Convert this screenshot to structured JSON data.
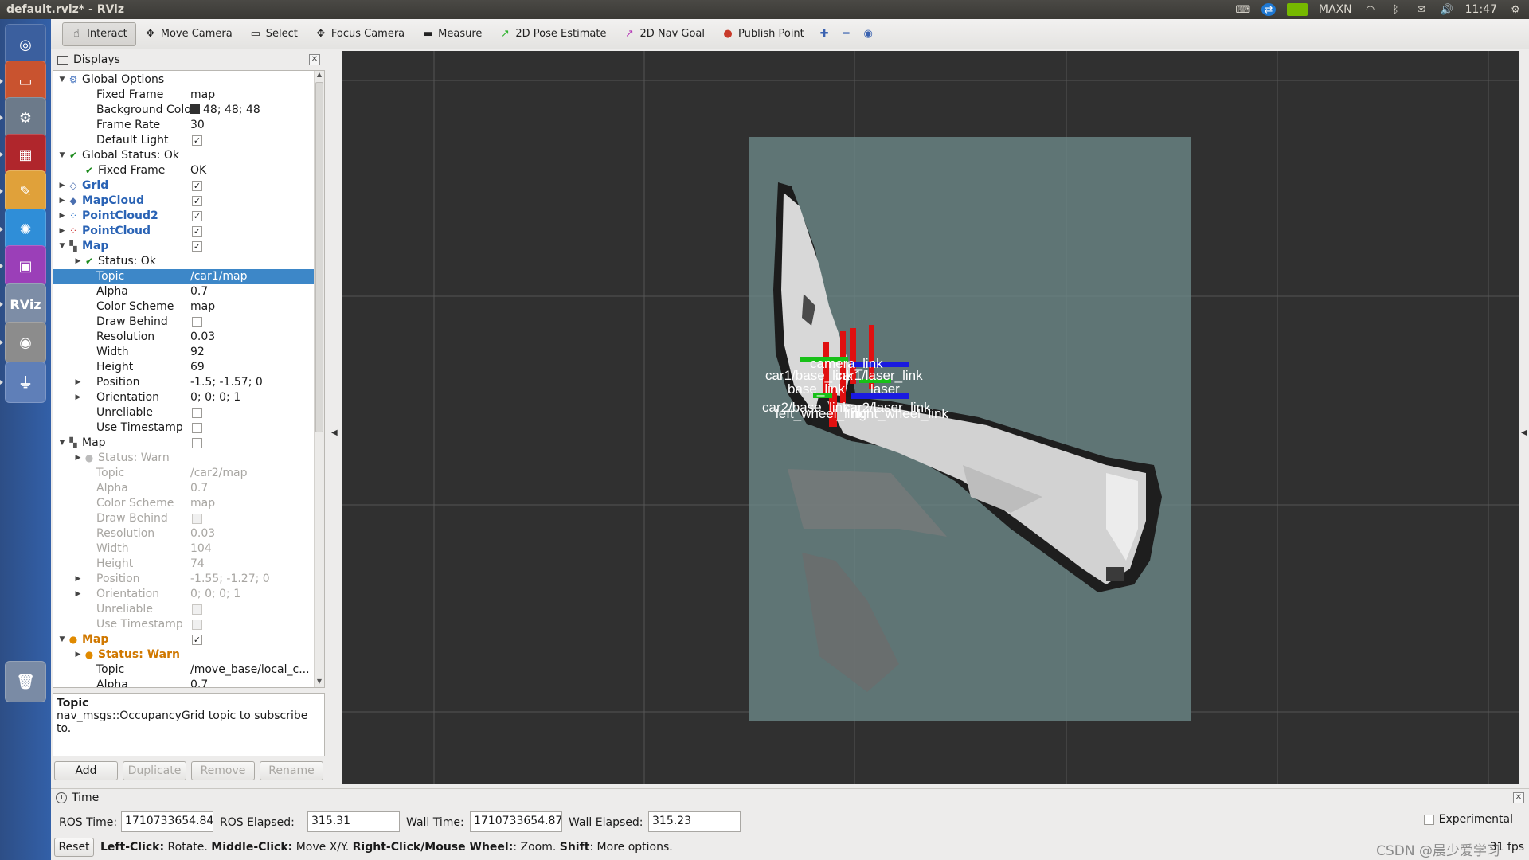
{
  "window": {
    "title": "default.rviz* - RViz"
  },
  "tray": {
    "network_label": "MAXN",
    "clock": "11:47"
  },
  "launcher": [
    {
      "name": "ubuntu-dash",
      "glyph": "◎",
      "color": "#3b5f9e"
    },
    {
      "name": "files",
      "glyph": "▭",
      "color": "#c9532f"
    },
    {
      "name": "system-settings",
      "glyph": "⚙",
      "color": "#6c7a8a"
    },
    {
      "name": "terminal-app",
      "glyph": "▦",
      "color": "#b0262c"
    },
    {
      "name": "text-editor",
      "glyph": "✎",
      "color": "#e0a13a"
    },
    {
      "name": "weather-app",
      "glyph": "✺",
      "color": "#2f8ed8"
    },
    {
      "name": "remote-desktop",
      "glyph": "▣",
      "color": "#9b3fb8"
    },
    {
      "name": "rviz-app",
      "glyph": "RViz",
      "color": "#7d8da6"
    },
    {
      "name": "screenshot-app",
      "glyph": "◉",
      "color": "#8c8c8c"
    },
    {
      "name": "usb-drive",
      "glyph": "⏚",
      "color": "#5f7fb8"
    },
    {
      "name": "trash",
      "glyph": "🗑",
      "color": "#7a8ba5"
    }
  ],
  "toolbar": {
    "tools": [
      {
        "label": "Interact",
        "icon": "hand-icon",
        "glyph": "☝",
        "active": true
      },
      {
        "label": "Move Camera",
        "icon": "move-camera-icon",
        "glyph": "✥"
      },
      {
        "label": "Select",
        "icon": "select-icon",
        "glyph": "▭"
      },
      {
        "label": "Focus Camera",
        "icon": "focus-camera-icon",
        "glyph": "✥"
      },
      {
        "label": "Measure",
        "icon": "ruler-icon",
        "glyph": "▬"
      },
      {
        "label": "2D Pose Estimate",
        "icon": "pose-arrow-icon",
        "glyph": "↗",
        "color": "#2db32d"
      },
      {
        "label": "2D Nav Goal",
        "icon": "nav-goal-arrow-icon",
        "glyph": "↗",
        "color": "#b12db3"
      },
      {
        "label": "Publish Point",
        "icon": "map-pin-icon",
        "glyph": "●",
        "color": "#c83a2a"
      }
    ],
    "extras": [
      "plus-icon",
      "minus-icon",
      "eye-icon"
    ]
  },
  "displays": {
    "title": "Displays",
    "rows": [
      {
        "indent": 0,
        "arrow": "down",
        "icon": "globe-icon",
        "label": "Global Options",
        "value": ""
      },
      {
        "indent": 1,
        "label": "Fixed Frame",
        "value": "map"
      },
      {
        "indent": 1,
        "label": "Background Color",
        "value": "48; 48; 48",
        "swatch": "#303030"
      },
      {
        "indent": 1,
        "label": "Frame Rate",
        "value": "30"
      },
      {
        "indent": 1,
        "label": "Default Light",
        "check": true
      },
      {
        "indent": 0,
        "arrow": "down",
        "icon": "check-icon",
        "label": "Global Status: Ok",
        "value": ""
      },
      {
        "indent": 1,
        "icon": "check-icon",
        "label": "Fixed Frame",
        "value": "OK"
      },
      {
        "indent": 0,
        "arrow": "right",
        "icon": "grid-icon",
        "label": "Grid",
        "check": true,
        "style": "blue"
      },
      {
        "indent": 0,
        "arrow": "right",
        "icon": "mapcloud-icon",
        "label": "MapCloud",
        "check": true,
        "style": "blue"
      },
      {
        "indent": 0,
        "arrow": "right",
        "icon": "pointcloud2-icon",
        "label": "PointCloud2",
        "check": true,
        "style": "blue"
      },
      {
        "indent": 0,
        "arrow": "right",
        "icon": "pointcloud-icon",
        "label": "PointCloud",
        "check": true,
        "style": "blue"
      },
      {
        "indent": 0,
        "arrow": "down",
        "icon": "map-icon",
        "label": "Map",
        "check": true,
        "style": "blue"
      },
      {
        "indent": 1,
        "arrow": "right",
        "icon": "check-icon",
        "label": "Status: Ok",
        "value": ""
      },
      {
        "indent": 1,
        "label": "Topic",
        "value": "/car1/map",
        "selected": true
      },
      {
        "indent": 1,
        "label": "Alpha",
        "value": "0.7"
      },
      {
        "indent": 1,
        "label": "Color Scheme",
        "value": "map"
      },
      {
        "indent": 1,
        "label": "Draw Behind",
        "check": false
      },
      {
        "indent": 1,
        "label": "Resolution",
        "value": "0.03"
      },
      {
        "indent": 1,
        "label": "Width",
        "value": "92"
      },
      {
        "indent": 1,
        "label": "Height",
        "value": "69"
      },
      {
        "indent": 1,
        "arrow": "right",
        "label": "Position",
        "value": "-1.5; -1.57; 0"
      },
      {
        "indent": 1,
        "arrow": "right",
        "label": "Orientation",
        "value": "0; 0; 0; 1"
      },
      {
        "indent": 1,
        "label": "Unreliable",
        "check": false
      },
      {
        "indent": 1,
        "label": "Use Timestamp",
        "check": false
      },
      {
        "indent": 0,
        "arrow": "down",
        "icon": "map-icon",
        "label": "Map",
        "check": false
      },
      {
        "indent": 1,
        "arrow": "right",
        "icon": "info-icon",
        "label": "Status: Warn",
        "value": "",
        "style": "dim"
      },
      {
        "indent": 1,
        "label": "Topic",
        "value": "/car2/map",
        "style": "dim"
      },
      {
        "indent": 1,
        "label": "Alpha",
        "value": "0.7",
        "style": "dim"
      },
      {
        "indent": 1,
        "label": "Color Scheme",
        "value": "map",
        "style": "dim"
      },
      {
        "indent": 1,
        "label": "Draw Behind",
        "check": false,
        "style": "dim"
      },
      {
        "indent": 1,
        "label": "Resolution",
        "value": "0.03",
        "style": "dim"
      },
      {
        "indent": 1,
        "label": "Width",
        "value": "104",
        "style": "dim"
      },
      {
        "indent": 1,
        "label": "Height",
        "value": "74",
        "style": "dim"
      },
      {
        "indent": 1,
        "arrow": "right",
        "label": "Position",
        "value": "-1.55; -1.27; 0",
        "style": "dim"
      },
      {
        "indent": 1,
        "arrow": "right",
        "label": "Orientation",
        "value": "0; 0; 0; 1",
        "style": "dim"
      },
      {
        "indent": 1,
        "label": "Unreliable",
        "check": false,
        "style": "dim"
      },
      {
        "indent": 1,
        "label": "Use Timestamp",
        "check": false,
        "style": "dim"
      },
      {
        "indent": 0,
        "arrow": "down",
        "icon": "warning-icon",
        "label": "Map",
        "check": true,
        "style": "orange"
      },
      {
        "indent": 1,
        "arrow": "right",
        "icon": "warning-icon",
        "label": "Status: Warn",
        "value": "",
        "style": "orange"
      },
      {
        "indent": 1,
        "label": "Topic",
        "value": "/move_base/local_c..."
      },
      {
        "indent": 1,
        "label": "Alpha",
        "value": "0.7"
      }
    ],
    "help_title": "Topic",
    "help_text": "nav_msgs::OccupancyGrid topic to subscribe to.",
    "buttons": [
      {
        "label": "Add",
        "enabled": true
      },
      {
        "label": "Duplicate",
        "enabled": false
      },
      {
        "label": "Remove",
        "enabled": false
      },
      {
        "label": "Rename",
        "enabled": false
      }
    ]
  },
  "viewport": {
    "background": "#303030",
    "frame_labels": [
      "camera_link",
      "car1/base_link",
      "car1/laser_link",
      "base_link",
      "laser",
      "car2/base_link",
      "car2/laser_link",
      "left_wheel_link",
      "right_wheel_link"
    ]
  },
  "time": {
    "title": "Time",
    "ros_time_label": "ROS Time:",
    "ros_time": "1710733654.84",
    "ros_elapsed_label": "ROS Elapsed:",
    "ros_elapsed": "315.31",
    "wall_time_label": "Wall Time:",
    "wall_time": "1710733654.87",
    "wall_elapsed_label": "Wall Elapsed:",
    "wall_elapsed": "315.23",
    "experimental_label": "Experimental"
  },
  "status": {
    "reset_label": "Reset",
    "hint_parts": [
      {
        "text": "Left-Click:",
        "bold": true
      },
      {
        "text": " Rotate. ",
        "bold": false
      },
      {
        "text": "Middle-Click:",
        "bold": true
      },
      {
        "text": " Move X/Y. ",
        "bold": false
      },
      {
        "text": "Right-Click/Mouse Wheel:",
        "bold": true
      },
      {
        "text": ": Zoom. ",
        "bold": false
      },
      {
        "text": "Shift",
        "bold": true
      },
      {
        "text": ": More options.",
        "bold": false
      }
    ],
    "fps": "31 fps",
    "watermark": "CSDN @晨少爱学习"
  }
}
